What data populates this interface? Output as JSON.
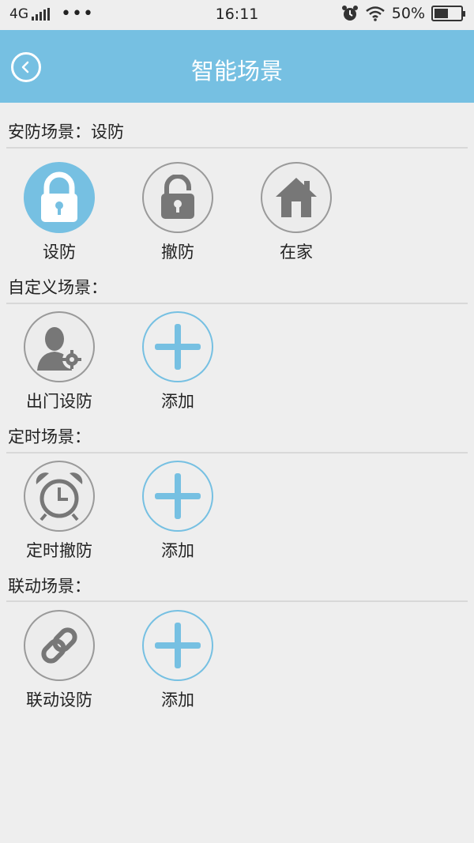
{
  "status_bar": {
    "network": "4G",
    "dots": "•••",
    "time": "16:11",
    "battery": "50%"
  },
  "header": {
    "title": "智能场景",
    "back_icon": "back-icon"
  },
  "sections": {
    "security": {
      "title": "安防场景：设防",
      "items": [
        {
          "label": "设防",
          "icon": "lock-closed-icon",
          "active": true
        },
        {
          "label": "撤防",
          "icon": "lock-open-icon",
          "active": false
        },
        {
          "label": "在家",
          "icon": "home-icon",
          "active": false
        }
      ]
    },
    "custom": {
      "title": "自定义场景：",
      "items": [
        {
          "label": "出门设防",
          "icon": "user-settings-icon"
        },
        {
          "label": "添加",
          "icon": "plus-icon"
        }
      ]
    },
    "timer": {
      "title": "定时场景：",
      "items": [
        {
          "label": "定时撤防",
          "icon": "alarm-clock-icon"
        },
        {
          "label": "添加",
          "icon": "plus-icon"
        }
      ]
    },
    "linkage": {
      "title": "联动场景：",
      "items": [
        {
          "label": "联动设防",
          "icon": "link-icon"
        },
        {
          "label": "添加",
          "icon": "plus-icon"
        }
      ]
    }
  },
  "colors": {
    "accent": "#76c0e2",
    "icon_gray": "#777777",
    "background": "#eeeeee"
  }
}
